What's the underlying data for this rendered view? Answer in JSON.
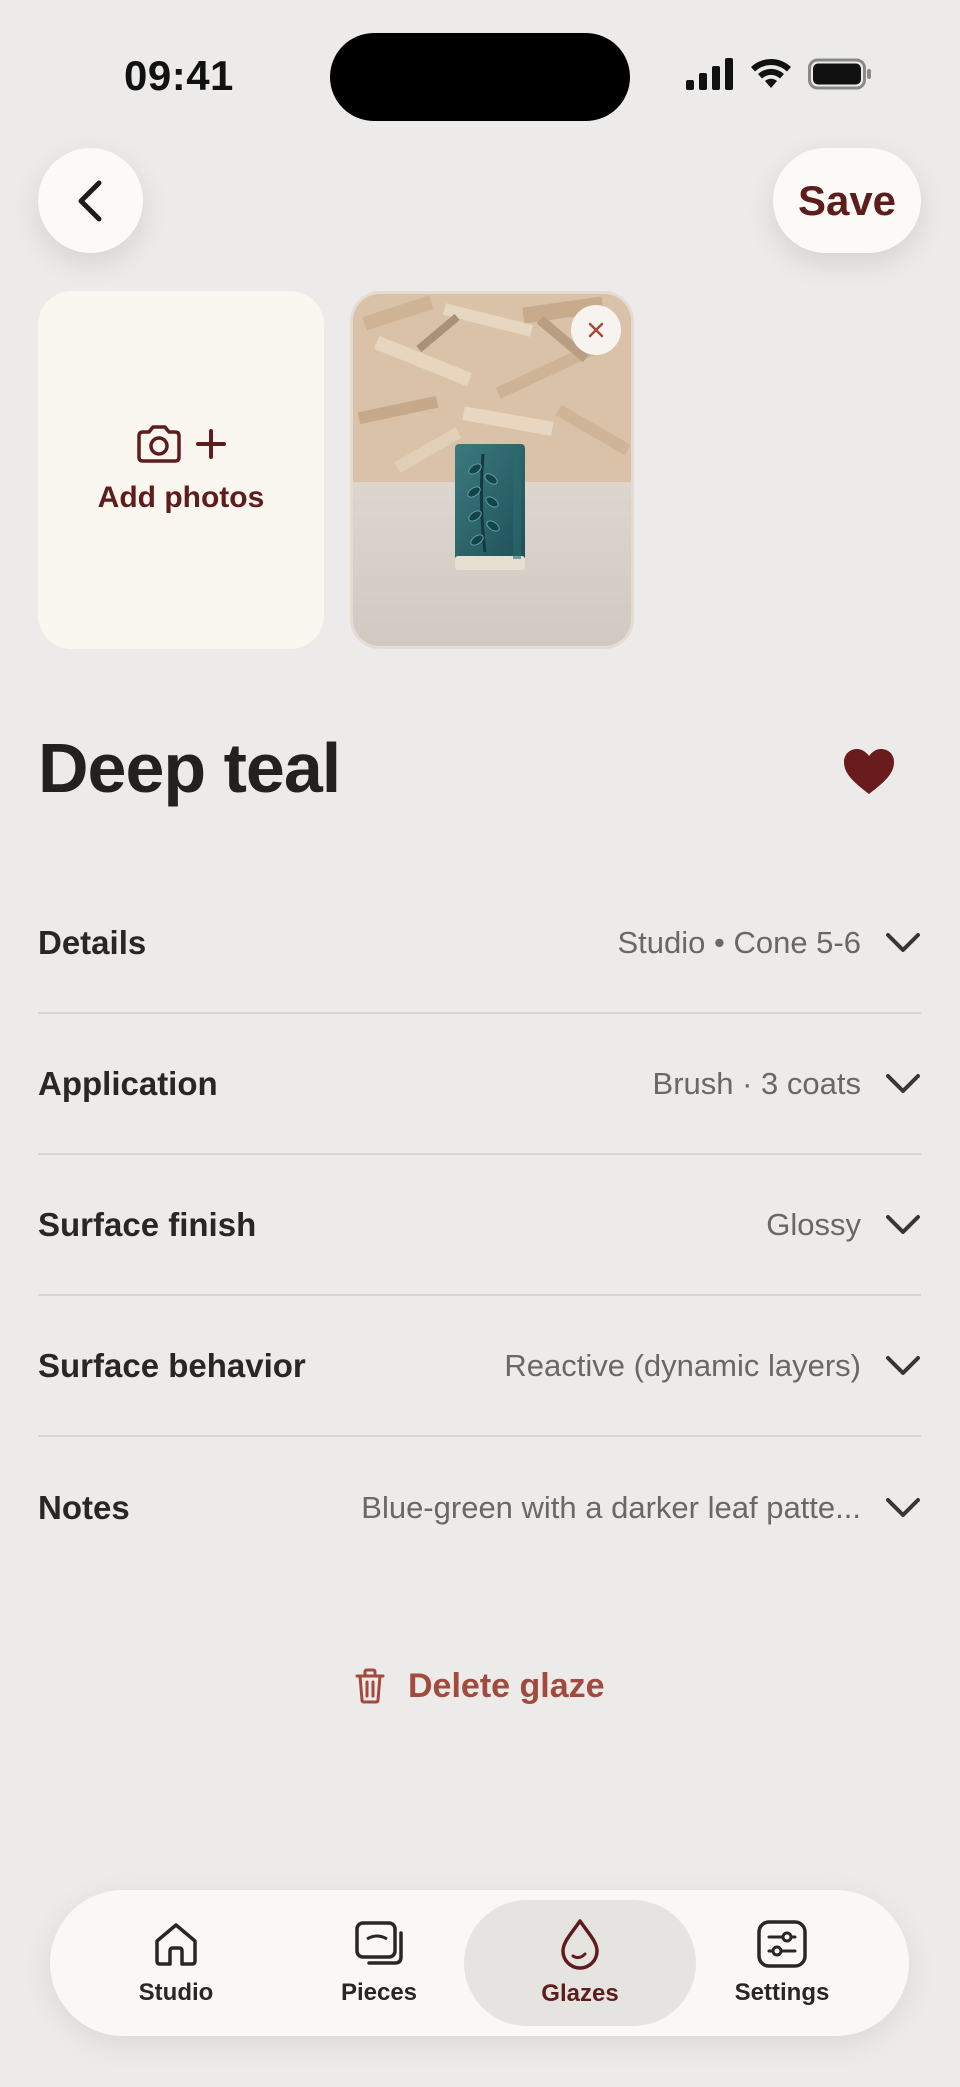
{
  "status_bar": {
    "time": "09:41"
  },
  "header": {
    "save_label": "Save"
  },
  "photos": {
    "add_label": "Add photos"
  },
  "glaze": {
    "title": "Deep teal",
    "favorite": true
  },
  "rows": [
    {
      "label": "Details",
      "value": "Studio • Cone 5-6"
    },
    {
      "label": "Application",
      "value": "Brush · 3 coats"
    },
    {
      "label": "Surface finish",
      "value": "Glossy"
    },
    {
      "label": "Surface behavior",
      "value": "Reactive (dynamic layers)"
    },
    {
      "label": "Notes",
      "value": "Blue-green with a darker leaf patte..."
    }
  ],
  "delete": {
    "label": "Delete glaze"
  },
  "tabs": [
    {
      "label": "Studio",
      "icon": "home-icon",
      "active": false
    },
    {
      "label": "Pieces",
      "icon": "pieces-icon",
      "active": false
    },
    {
      "label": "Glazes",
      "icon": "drop-icon",
      "active": true
    },
    {
      "label": "Settings",
      "icon": "settings-sliders-icon",
      "active": false
    }
  ],
  "colors": {
    "accent": "#5e1c1c",
    "delete": "#a24a3e",
    "background": "#ecebe9"
  }
}
